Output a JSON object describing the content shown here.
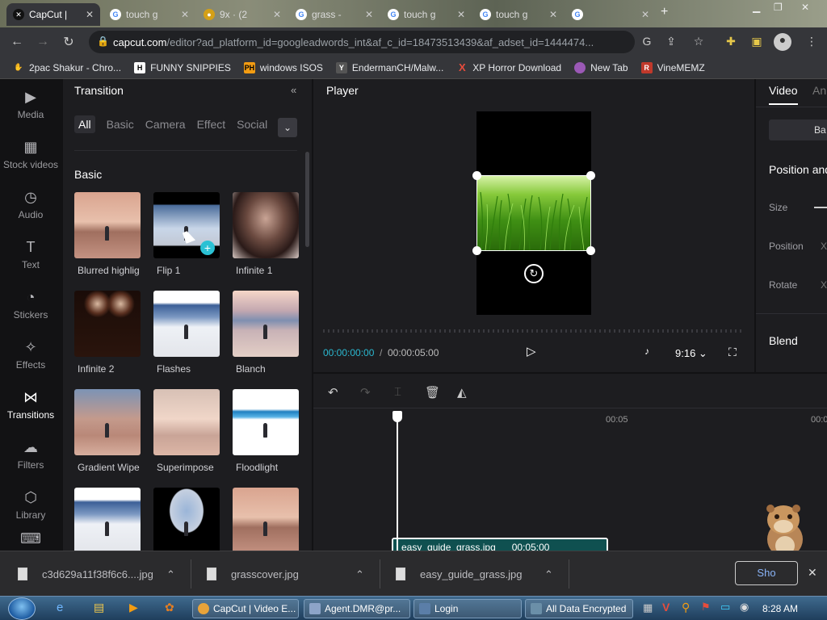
{
  "browser": {
    "tabs": [
      {
        "label": "CapCut |",
        "active": true
      },
      {
        "label": "touch g"
      },
      {
        "label": "9x · (2"
      },
      {
        "label": "grass -"
      },
      {
        "label": "touch g"
      },
      {
        "label": "touch g"
      },
      {
        "label": ""
      }
    ],
    "new_tab": "+",
    "url_host": "capcut.com",
    "url_path": "/editor?ad_platform_id=googleadwords_int&af_c_id=18473513439&af_adset_id=1444474...",
    "bookmarks": [
      {
        "label": "2pac Shakur - Chro...",
        "icon_color": "#c0392b"
      },
      {
        "label": "FUNNY SNIPPIES",
        "icon_color": "#ffffff",
        "icon_text": "H"
      },
      {
        "label": "windows ISOS",
        "icon_color": "#f39c12",
        "icon_text": "PH"
      },
      {
        "label": "EndermanCH/Malw...",
        "icon_color": "#555555",
        "icon_text": "Y"
      },
      {
        "label": "XP Horror Download",
        "icon_color": "#e74c3c",
        "icon_text": "X"
      },
      {
        "label": "New Tab",
        "icon_color": "#9b59b6"
      },
      {
        "label": "VineMEMZ",
        "icon_color": "#c0392b",
        "icon_text": "R"
      }
    ]
  },
  "leftnav": [
    {
      "label": "Media",
      "icon": "media-icon",
      "glyph": "▶"
    },
    {
      "label": "Stock videos",
      "icon": "stock-videos-icon",
      "glyph": "▦"
    },
    {
      "label": "Audio",
      "icon": "audio-icon",
      "glyph": "◷"
    },
    {
      "label": "Text",
      "icon": "text-icon",
      "glyph": "T"
    },
    {
      "label": "Stickers",
      "icon": "stickers-icon",
      "glyph": "◔"
    },
    {
      "label": "Effects",
      "icon": "effects-icon",
      "glyph": "✧"
    },
    {
      "label": "Transitions",
      "icon": "transitions-icon",
      "glyph": "⋈",
      "active": true
    },
    {
      "label": "Filters",
      "icon": "filters-icon",
      "glyph": "☁"
    },
    {
      "label": "Library",
      "icon": "library-icon",
      "glyph": "⬡"
    }
  ],
  "transition_panel": {
    "title": "Transition",
    "filters": [
      "All",
      "Basic",
      "Camera",
      "Effect",
      "Social"
    ],
    "section": "Basic",
    "items": [
      {
        "label": "Blurred highlig",
        "style": "sunset"
      },
      {
        "label": "Flip 1",
        "style": "flip"
      },
      {
        "label": "Infinite 1",
        "style": "portrait"
      },
      {
        "label": "Infinite 2",
        "style": "dark"
      },
      {
        "label": "Flashes",
        "style": "lake"
      },
      {
        "label": "Blanch",
        "style": "lake2"
      },
      {
        "label": "Gradient Wipe",
        "style": "sunset2"
      },
      {
        "label": "Superimpose",
        "style": "sunset3"
      },
      {
        "label": "Floodlight",
        "style": "flood"
      },
      {
        "label": "",
        "style": "lake"
      },
      {
        "label": "",
        "style": "dark2"
      },
      {
        "label": "",
        "style": "sunset"
      }
    ]
  },
  "player": {
    "title": "Player",
    "current_time": "00:00:00:00",
    "separator": "/",
    "total_time": "00:00:05:00",
    "ratio": "9:16"
  },
  "right_panel": {
    "tab_video": "Video",
    "tab_animation": "An",
    "basic_btn": "Ba",
    "section_position": "Position and",
    "size": "Size",
    "position": "Position",
    "position_x": "X",
    "rotate": "Rotate",
    "rotate_x": "X",
    "blend": "Blend"
  },
  "timeline": {
    "mark1": "00:05",
    "mark2": "00:0",
    "clip_name": "easy_guide_grass.jpg",
    "clip_duration": "00:05:00"
  },
  "downloads": [
    {
      "name": "c3d629a11f38f6c6....jpg"
    },
    {
      "name": "grasscover.jpg"
    },
    {
      "name": "easy_guide_grass.jpg"
    }
  ],
  "show_all": "Sho",
  "taskbar": {
    "items": [
      {
        "label": "CapCut | Video E...",
        "color": "#e8a33a"
      },
      {
        "label": "Agent.DMR@pr...",
        "color": "#8da4c8"
      },
      {
        "label": "Login",
        "color": "#5b7ea8"
      },
      {
        "label": "All Data Encrypted",
        "color": "#6b8fa8"
      }
    ],
    "clock": "8:28 AM"
  }
}
